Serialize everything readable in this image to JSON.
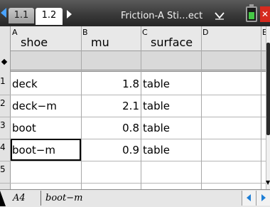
{
  "titlebar": {
    "tabs": [
      {
        "label": "1.1"
      },
      {
        "label": "1.2"
      }
    ],
    "document_title": "Friction-A Sti…ect",
    "accent": "#4aa3ff"
  },
  "columns": [
    {
      "letter": "A",
      "name": "shoe"
    },
    {
      "letter": "B",
      "name": "mu"
    },
    {
      "letter": "C",
      "name": "surface"
    },
    {
      "letter": "D",
      "name": ""
    },
    {
      "letter": "E",
      "name": ""
    }
  ],
  "rows": [
    {
      "num": "1",
      "shoe": "deck",
      "mu": "1.8",
      "surface": "table"
    },
    {
      "num": "2",
      "shoe": "deck−m",
      "mu": "2.1",
      "surface": "table"
    },
    {
      "num": "3",
      "shoe": "boot",
      "mu": "0.8",
      "surface": "table"
    },
    {
      "num": "4",
      "shoe": "boot−m",
      "mu": "0.9",
      "surface": "table"
    },
    {
      "num": "5",
      "shoe": "",
      "mu": "",
      "surface": ""
    }
  ],
  "entry_line": {
    "cell_ref": "A4",
    "value": "boot−m"
  },
  "icons": {
    "prev_page": "chevron-left-icon",
    "next_page": "chevron-right-icon",
    "document_menu": "chevron-down-icon",
    "battery": "battery-icon",
    "close": "close-icon",
    "formula_row": "diamond-icon"
  }
}
